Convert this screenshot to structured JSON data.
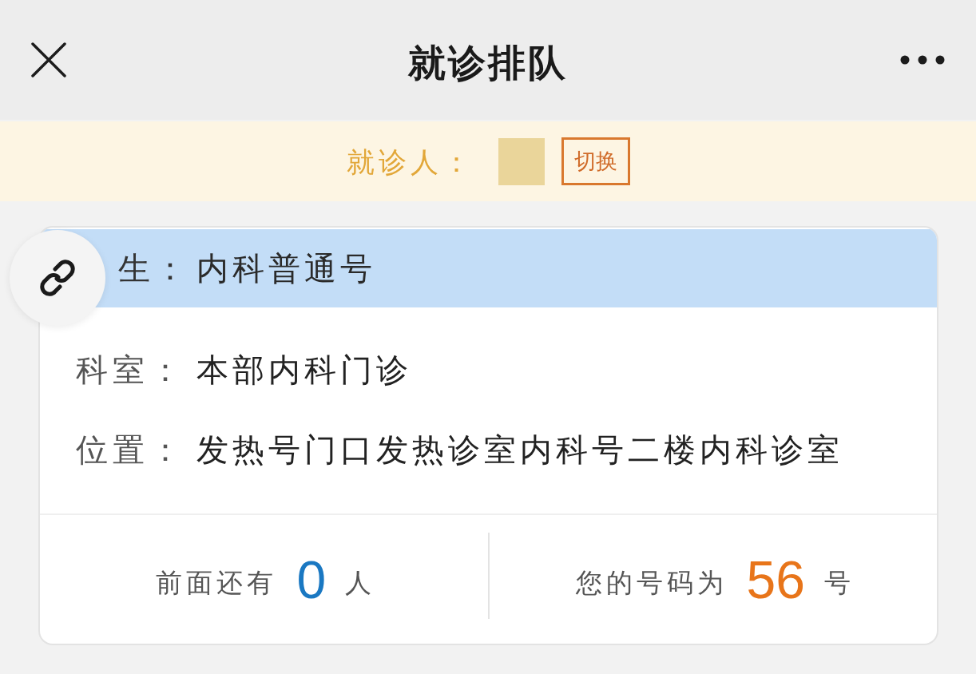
{
  "nav": {
    "title": "就诊排队"
  },
  "patient_bar": {
    "label": "就诊人：",
    "switch_button": "切换"
  },
  "queue_card": {
    "header": {
      "label": "生：",
      "value": "内科普通号"
    },
    "rows": [
      {
        "label": "科室：",
        "value": "本部内科门诊"
      },
      {
        "label": "位置：",
        "value": "发热号门口发热诊室内科号二楼内科诊室"
      }
    ],
    "stats": [
      {
        "prefix": "前面还有",
        "number": "0",
        "suffix": "人",
        "color": "#1a78c2"
      },
      {
        "prefix": "您的号码为",
        "number": "56",
        "suffix": "号",
        "color": "#e8751a"
      }
    ]
  }
}
